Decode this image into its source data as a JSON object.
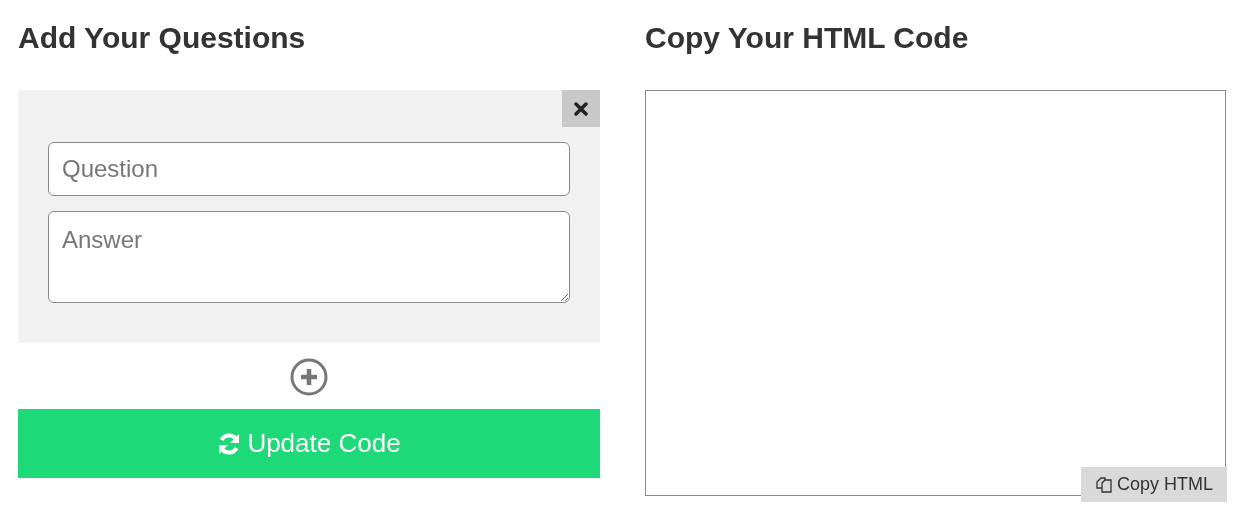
{
  "left": {
    "heading": "Add Your Questions",
    "question_cards": [
      {
        "question": {
          "placeholder": "Question"
        },
        "answer": {
          "placeholder": "Answer"
        }
      }
    ],
    "update_button": {
      "label": "Update Code"
    }
  },
  "right": {
    "heading": "Copy Your HTML Code",
    "copy_button": {
      "label": "Copy HTML"
    }
  }
}
